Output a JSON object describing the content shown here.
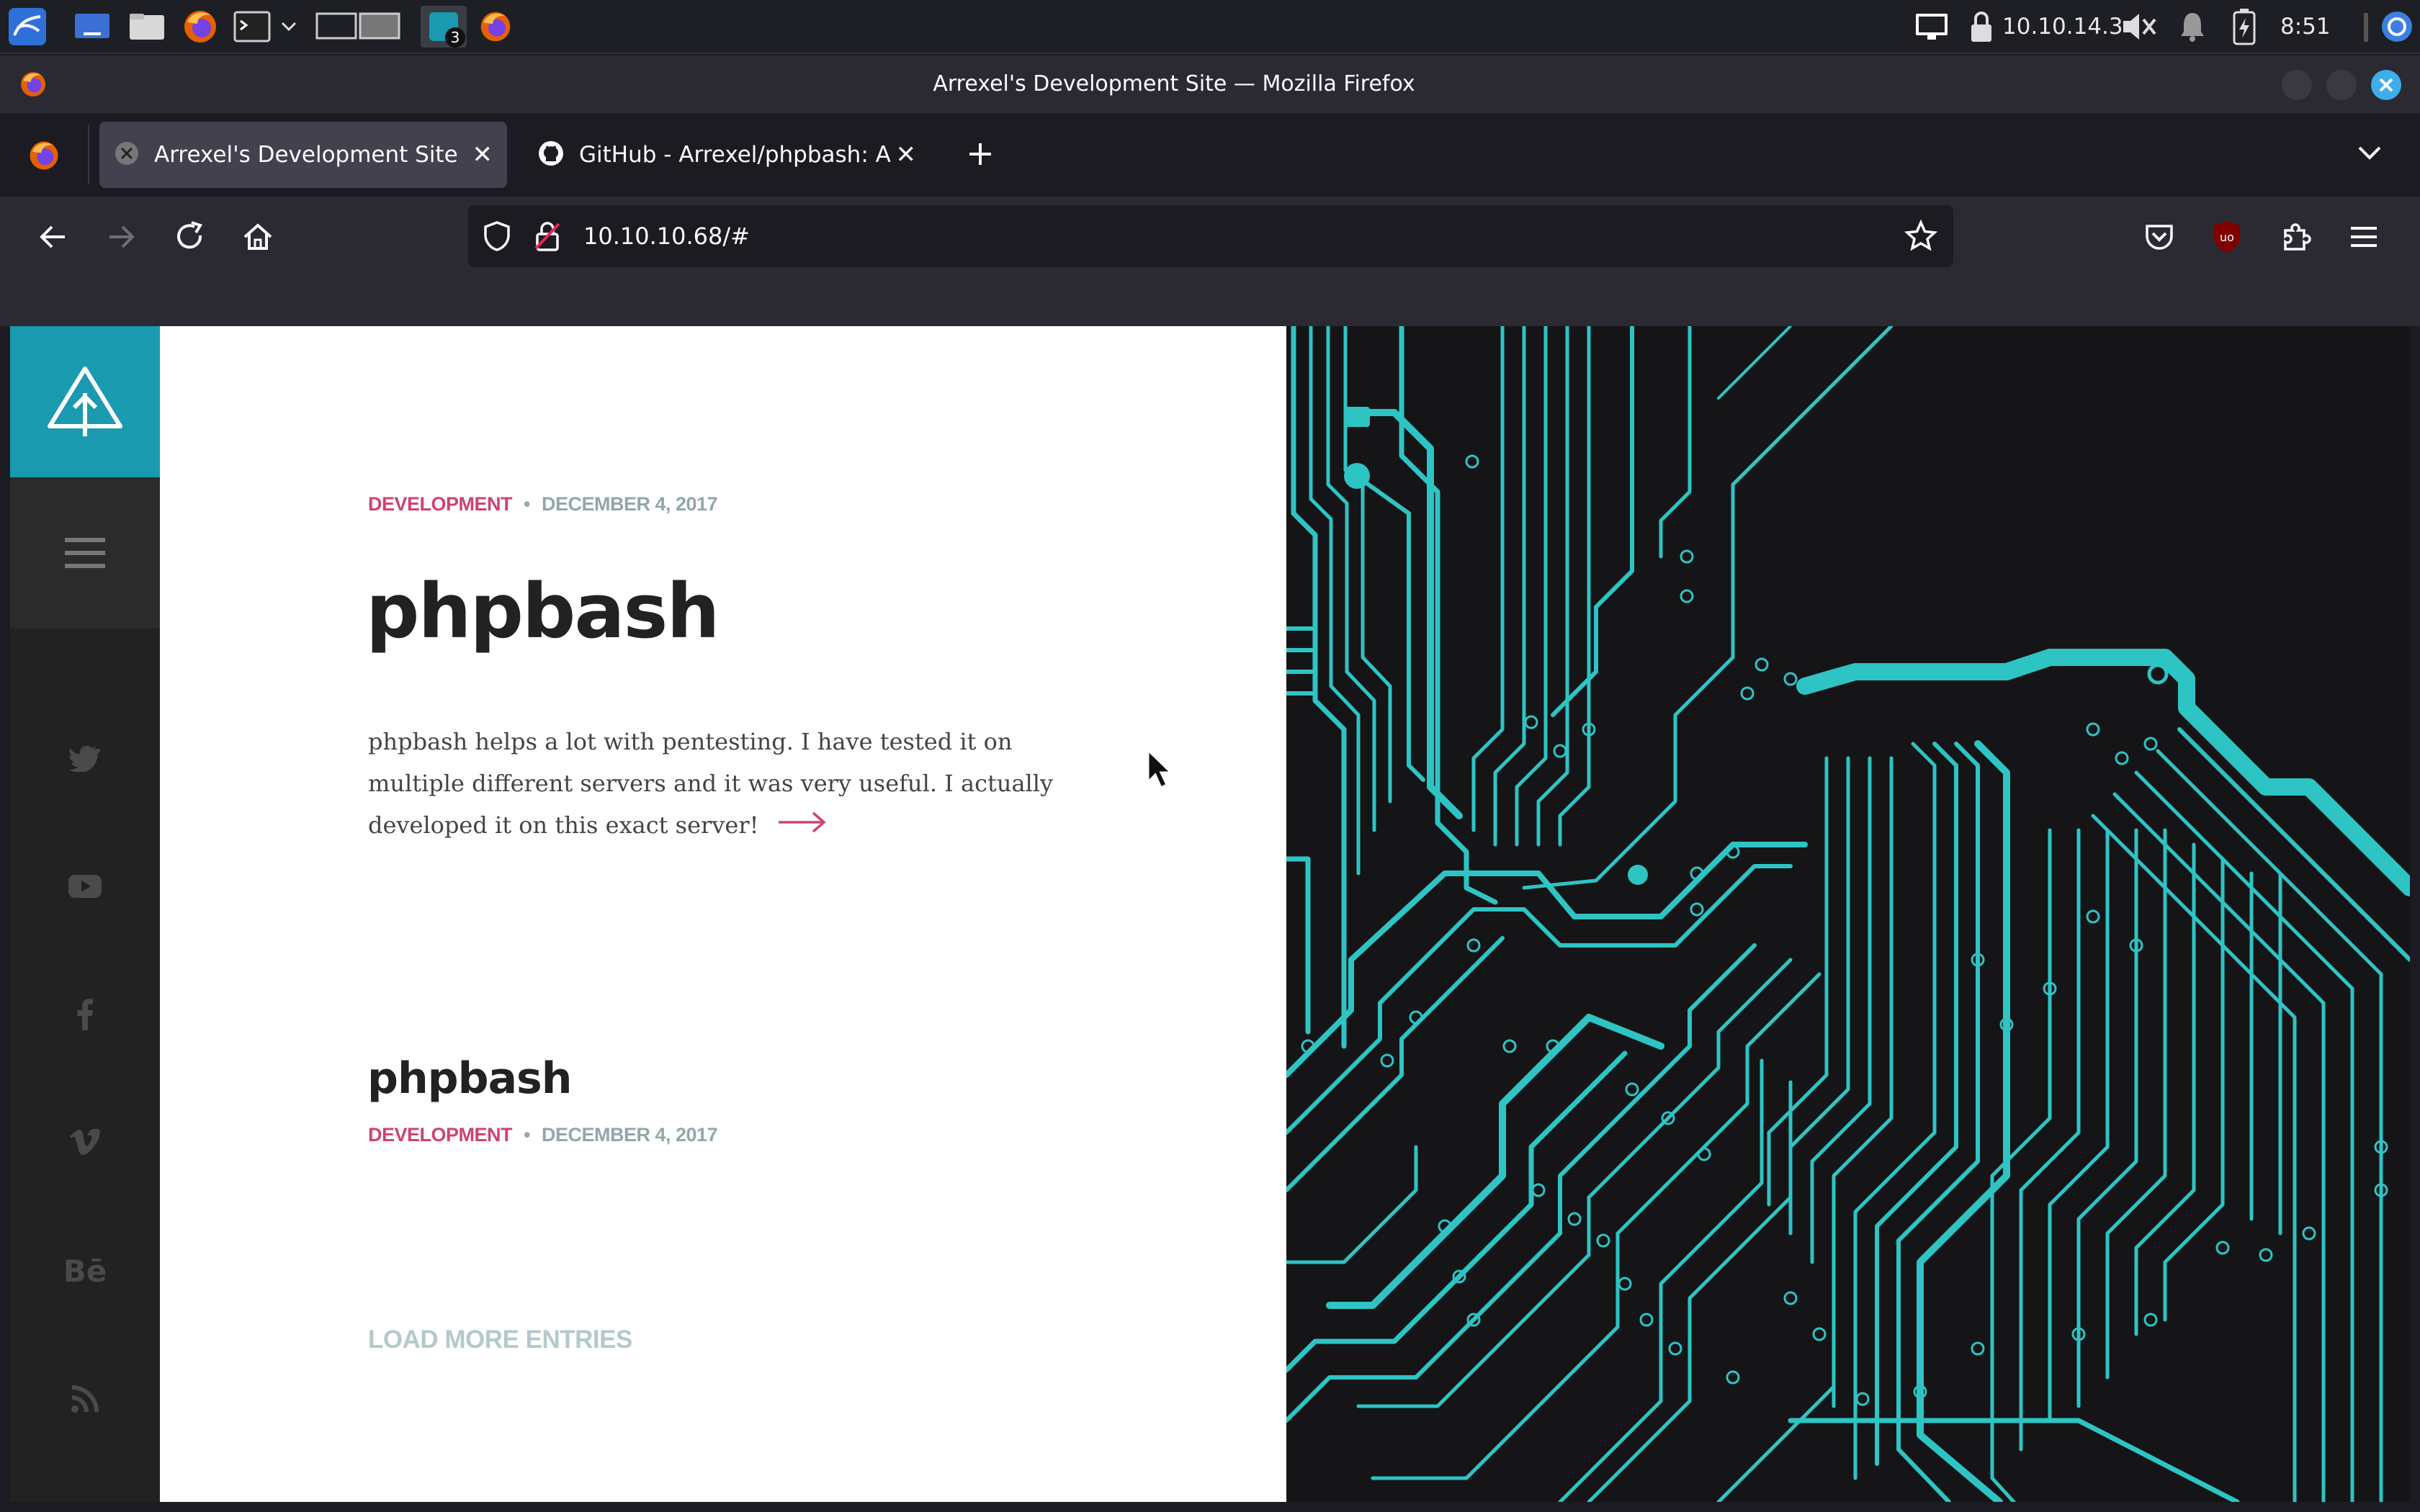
{
  "taskbar": {
    "workspace_badge": "3",
    "ip_address": "10.10.14.3",
    "clock": "8:51"
  },
  "window": {
    "title": "Arrexel's Development Site — Mozilla Firefox"
  },
  "tabs": [
    {
      "title": "Arrexel's Development Site",
      "active": true
    },
    {
      "title": "GitHub - Arrexel/phpbash: A",
      "active": false
    }
  ],
  "navbar": {
    "url": "10.10.10.68/#"
  },
  "page": {
    "featured": {
      "category": "DEVELOPMENT",
      "separator": "•",
      "date": "DECEMBER 4, 2017",
      "title": "phpbash",
      "excerpt": "phpbash helps a lot with pentesting. I have tested it on multiple different servers and it was very useful. I actually developed it on this exact server!"
    },
    "second_post": {
      "title": "phpbash",
      "category": "DEVELOPMENT",
      "separator": "•",
      "date": "DECEMBER 4, 2017"
    },
    "load_more": "LOAD MORE ENTRIES",
    "social": {
      "behance_label": "Bē"
    }
  },
  "colors": {
    "accent_teal": "#1a9aae",
    "category_pink": "#d0436f",
    "circuit_teal": "#2ec4c4"
  }
}
